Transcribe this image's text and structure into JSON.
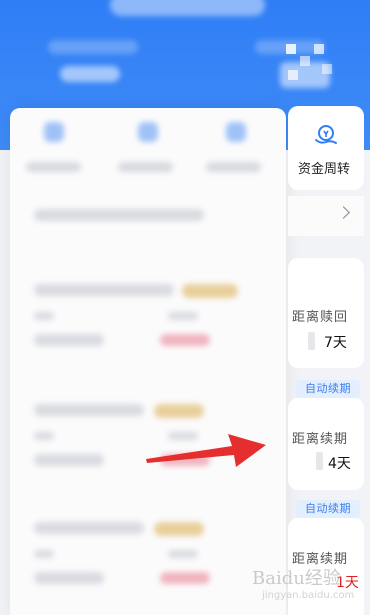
{
  "card_funds": {
    "label": "资金周转"
  },
  "cards": [
    {
      "label": "距离赎回",
      "days": "7天"
    },
    {
      "badge": "自动续期",
      "label": "距离续期",
      "days": "4天"
    },
    {
      "badge": "自动续期",
      "label": "距离续期",
      "days": "1天"
    }
  ],
  "colors": {
    "primary_blue": "#2f7ef6",
    "arrow_red": "#e52f2f",
    "badge_bg": "#e3eefe",
    "badge_text": "#3a7ef1"
  },
  "watermark": {
    "text": "Baidu经验",
    "sub": "jingyan.baidu.com"
  }
}
